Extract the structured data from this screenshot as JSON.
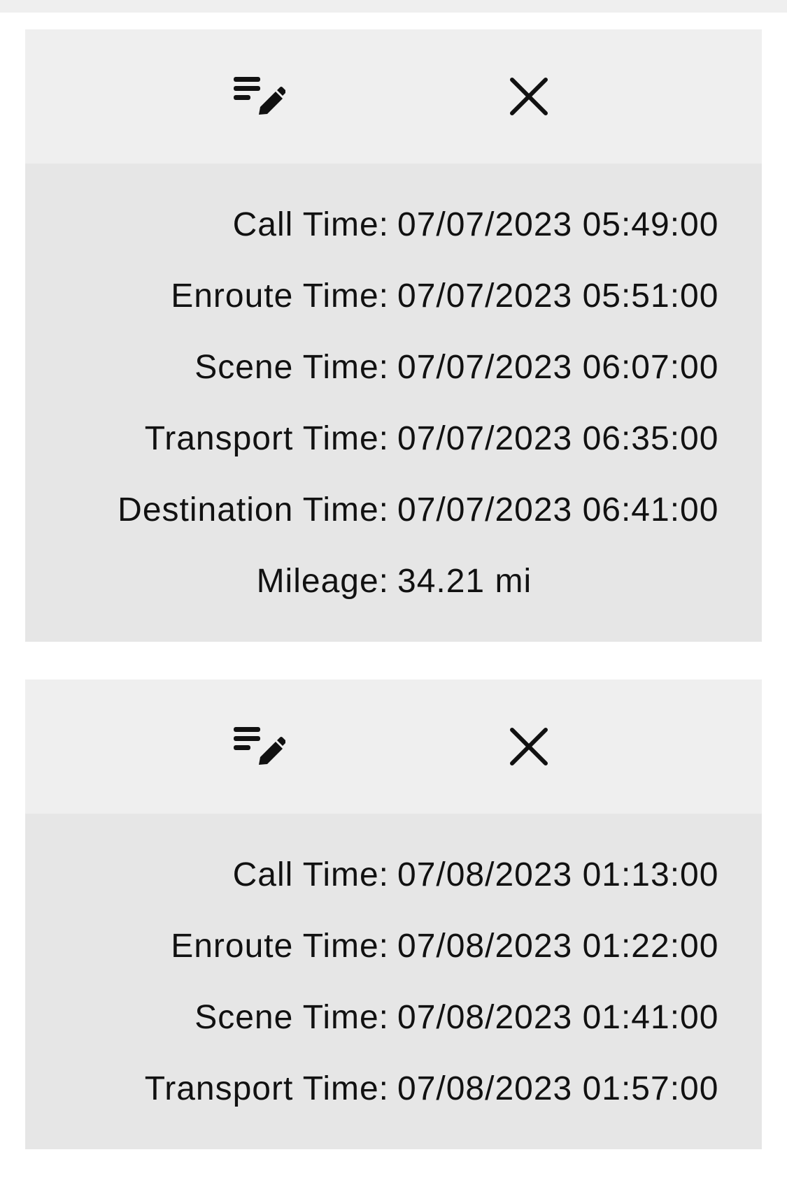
{
  "records": [
    {
      "toolbar": {
        "edit_icon": "edit-note-icon",
        "close_icon": "close-icon"
      },
      "fields": [
        {
          "label": "Call Time:",
          "value": "07/07/2023 05:49:00"
        },
        {
          "label": "Enroute Time:",
          "value": "07/07/2023 05:51:00"
        },
        {
          "label": "Scene Time:",
          "value": "07/07/2023 06:07:00"
        },
        {
          "label": "Transport Time:",
          "value": "07/07/2023 06:35:00"
        },
        {
          "label": "Destination Time:",
          "value": "07/07/2023 06:41:00"
        },
        {
          "label": "Mileage:",
          "value": "34.21 mi"
        }
      ]
    },
    {
      "toolbar": {
        "edit_icon": "edit-note-icon",
        "close_icon": "close-icon"
      },
      "fields": [
        {
          "label": "Call Time:",
          "value": "07/08/2023 01:13:00"
        },
        {
          "label": "Enroute Time:",
          "value": "07/08/2023 01:22:00"
        },
        {
          "label": "Scene Time:",
          "value": "07/08/2023 01:41:00"
        },
        {
          "label": "Transport Time:",
          "value": "07/08/2023 01:57:00"
        }
      ]
    }
  ]
}
